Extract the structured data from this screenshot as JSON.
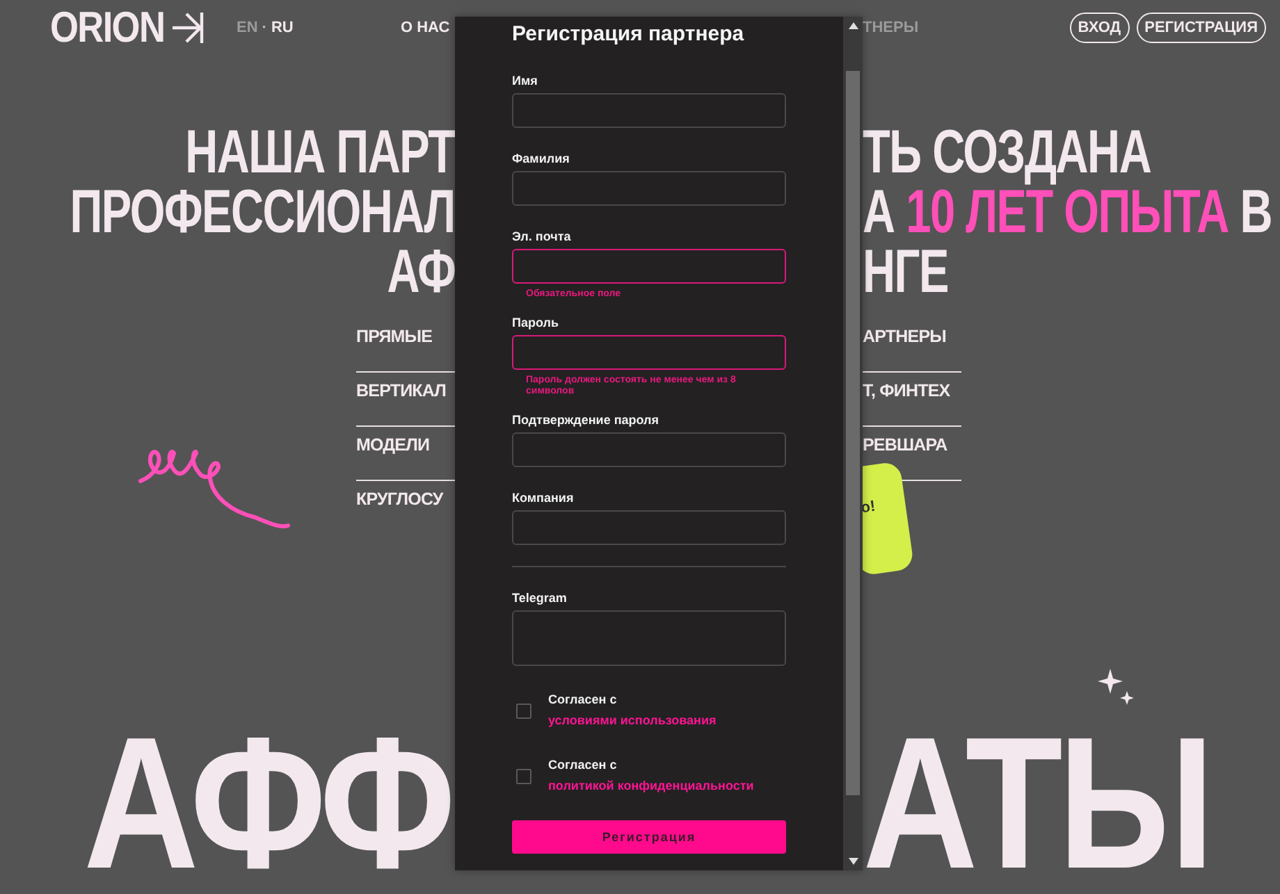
{
  "header": {
    "logo": "ORION",
    "languages": [
      {
        "label": "EN",
        "selected": false
      },
      {
        "label": "RU",
        "selected": true
      }
    ],
    "language_separator": "·",
    "nav": [
      {
        "label": "О НАС",
        "dimmed": false
      },
      {
        "label": "ТНЕРЫ",
        "dimmed": true
      }
    ],
    "buttons": [
      "ВХОД",
      "РЕГИСТРАЦИЯ"
    ]
  },
  "headline": [
    {
      "left": "НАША ПАРТ",
      "right": "ТЬ СОЗДАНА"
    },
    {
      "left": "ПРОФЕССИОНАЛ",
      "right": "А **10 ЛЕТ ОПЫТА** В"
    },
    {
      "left": "АФ",
      "right": "НГЕ"
    }
  ],
  "features": [
    {
      "left": "ПРЯМЫЕ",
      "right": "АРТНЕРЫ",
      "underlined": true
    },
    {
      "left": "ВЕРТИКАЛ",
      "right": "Т, ФИНТЕХ",
      "underlined": true
    },
    {
      "left": "МОДЕЛИ",
      "right": "РЕВШАРА",
      "underlined": true
    },
    {
      "left": "КРУГЛОСУ",
      "underlined": false
    }
  ],
  "sticker_text": "о!",
  "big_word": {
    "left": "АФФ",
    "right": "АТЫ"
  },
  "modal": {
    "title": "Регистрация партнера",
    "fields": [
      {
        "label": "Имя",
        "kind": "line",
        "invalid": false
      },
      {
        "label": "Фамилия",
        "kind": "line",
        "invalid": false
      },
      {
        "label": "Эл. почта",
        "kind": "line",
        "invalid": true,
        "error": "Обязательное поле"
      },
      {
        "label": "Пароль",
        "kind": "line",
        "invalid": true,
        "error": "Пароль должен состоять не менее чем из 8 символов"
      },
      {
        "label": "Подтверждение пароля",
        "kind": "line",
        "invalid": false
      },
      {
        "label": "Компания",
        "kind": "line",
        "invalid": false
      },
      {
        "label": "Telegram",
        "kind": "area",
        "invalid": false,
        "divider_before": true
      }
    ],
    "consents": [
      {
        "text": "Согласен с",
        "link": "условиями использования",
        "checked": false
      },
      {
        "text": "Согласен с",
        "link": "политикой конфиденциальности",
        "checked": false
      }
    ],
    "submit": "Регистрация"
  }
}
